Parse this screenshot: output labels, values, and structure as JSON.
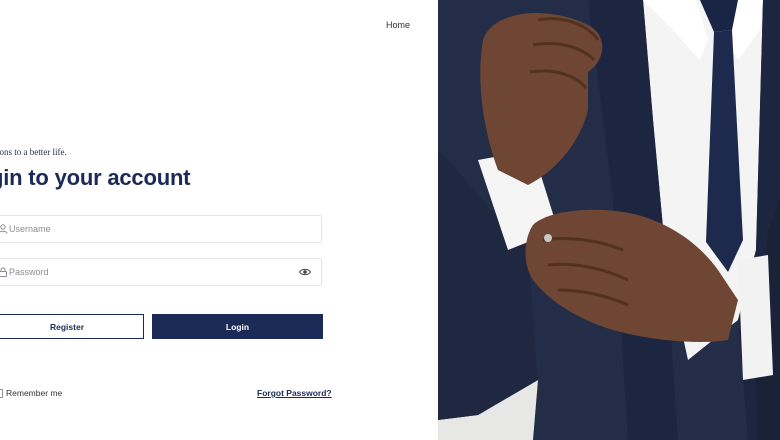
{
  "nav": {
    "home_label": "Home"
  },
  "login_form": {
    "tagline": "ions to a better life.",
    "heading": "gin to your account",
    "username": {
      "placeholder": "Username",
      "value": "",
      "icon": "user-icon"
    },
    "password": {
      "placeholder": "Password",
      "value": "",
      "icon": "lock-icon",
      "toggle_icon": "eye-icon"
    },
    "register_label": "Register",
    "login_label": "Login",
    "remember_label": "Remember me",
    "remember_checked": false,
    "forgot_label": "Forgot Password?"
  },
  "colors": {
    "primary": "#1b2a57",
    "border": "#e6e6ea",
    "placeholder": "#8c8c94",
    "photo_background": "#e7e7e6"
  },
  "hero_image": {
    "subject": "man-in-navy-suit-adjusting-shirt-cuff"
  }
}
